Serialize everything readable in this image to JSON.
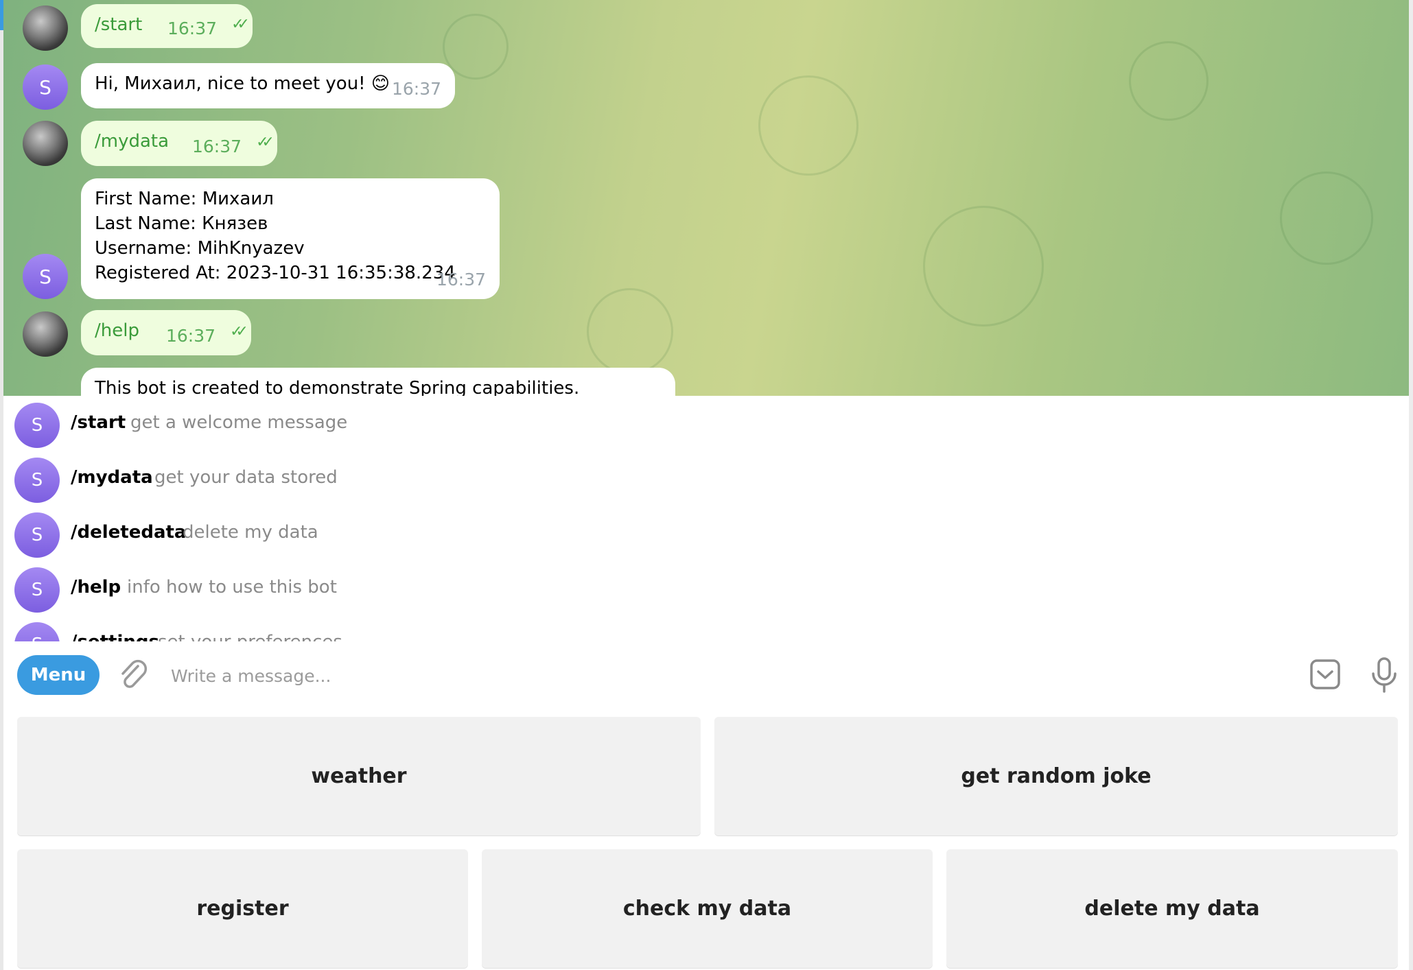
{
  "chat": {
    "messages": [
      {
        "direction": "out",
        "text": "/start",
        "time": "16:37",
        "status": "read"
      },
      {
        "direction": "in",
        "sender_initial": "S",
        "text": "Hi, Михаил, nice to meet you! 😊",
        "time": "16:37"
      },
      {
        "direction": "out",
        "text": "/mydata",
        "time": "16:37",
        "status": "read"
      },
      {
        "direction": "in",
        "sender_initial": "S",
        "lines": [
          "First Name: Михаил",
          "Last Name: Князев",
          "Username: MihKnyazev",
          "Registered At: 2023-10-31 16:35:38.234"
        ],
        "time": "16:37"
      },
      {
        "direction": "out",
        "text": "/help",
        "time": "16:37",
        "status": "read"
      },
      {
        "direction": "in",
        "text": "This bot is created to demonstrate Spring capabilities."
      }
    ]
  },
  "commands": [
    {
      "initial": "S",
      "name": "/start",
      "description": "get a welcome message"
    },
    {
      "initial": "S",
      "name": "/mydata",
      "description": "get your data stored"
    },
    {
      "initial": "S",
      "name": "/deletedata",
      "description": "delete my data"
    },
    {
      "initial": "S",
      "name": "/help",
      "description": "info how to use this bot"
    },
    {
      "initial": "S",
      "name": "/settings",
      "description": "set your preferences"
    }
  ],
  "input_bar": {
    "menu_label": "Menu",
    "placeholder": "Write a message..."
  },
  "keyboard": {
    "row1": [
      "weather",
      "get random joke"
    ],
    "row2": [
      "register",
      "check my data",
      "delete my data"
    ]
  },
  "colors": {
    "accent": "#3a9be0",
    "outgoing_bubble": "#effdde",
    "outgoing_text": "#3a9b3a",
    "bot_avatar": "#8b6ff0",
    "keyboard_button": "#f1f1f1"
  },
  "icons": [
    "attach-icon",
    "keyboard-toggle-icon",
    "microphone-icon",
    "double-check-icon"
  ]
}
